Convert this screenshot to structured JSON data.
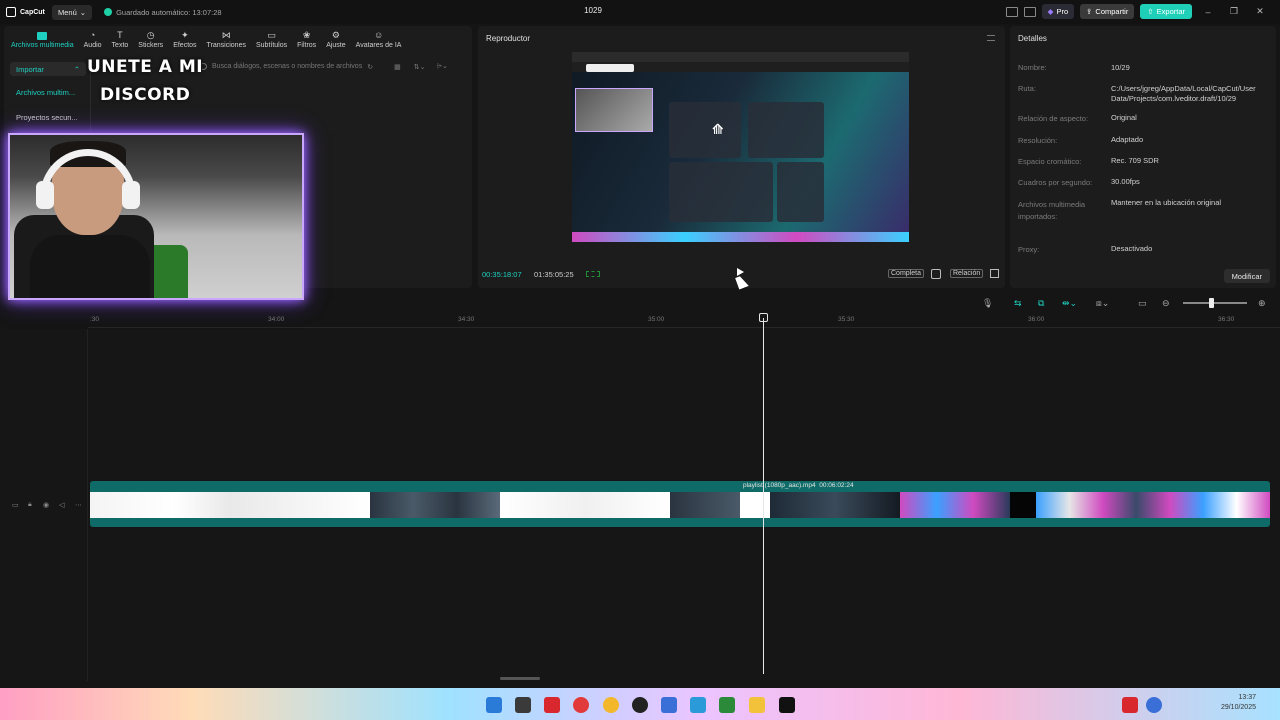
{
  "titlebar": {
    "app_name": "CapCut",
    "menu_label": "Menú",
    "autosave": "Guardado automático: 13:07:28",
    "project": "1029",
    "pro_label": "Pro",
    "share_label": "Compartir",
    "export_label": "Exportar"
  },
  "tools": [
    {
      "label": "Archivos multimedia",
      "icon": "media-icon"
    },
    {
      "label": "Audio",
      "icon": "audio-icon"
    },
    {
      "label": "Texto",
      "icon": "text-icon"
    },
    {
      "label": "Stickers",
      "icon": "sticker-icon"
    },
    {
      "label": "Efectos",
      "icon": "effects-icon"
    },
    {
      "label": "Transiciones",
      "icon": "transitions-icon"
    },
    {
      "label": "Subtítulos",
      "icon": "subtitles-icon"
    },
    {
      "label": "Filtros",
      "icon": "filters-icon"
    },
    {
      "label": "Ajuste",
      "icon": "adjust-icon"
    },
    {
      "label": "Avatares de IA",
      "icon": "avatar-icon"
    }
  ],
  "media": {
    "import_label": "Importar",
    "side_items": [
      "Archivos multim...",
      "Proyectos secun..."
    ],
    "search_placeholder": "Busca diálogos, escenas o nombres de archivos"
  },
  "overlay": {
    "line1": "UNETE A MI",
    "line2": "DISCORD"
  },
  "player": {
    "title": "Reproductor",
    "current_time": "00:35:18:07",
    "total_time": "01:35:05:25",
    "full_label": "Completa",
    "ratio_label": "Relación"
  },
  "details": {
    "title": "Detalles",
    "rows": [
      {
        "label": "Nombre:",
        "value": "10/29"
      },
      {
        "label": "Ruta:",
        "value": "C:/Users/jgreg/AppData/Local/CapCut/User Data/Projects/com.lveditor.draft/10/29"
      },
      {
        "label": "Relación de aspecto:",
        "value": "Original"
      },
      {
        "label": "Resolución:",
        "value": "Adaptado"
      },
      {
        "label": "Espacio cromático:",
        "value": "Rec. 709 SDR"
      },
      {
        "label": "Cuadros por segundo:",
        "value": "30.00fps"
      },
      {
        "label": "Archivos multimedia importados:",
        "value": "Mantener en la ubicación original"
      },
      {
        "label": "Proxy:",
        "value": "Desactivado"
      }
    ],
    "modify_label": "Modificar"
  },
  "timeline": {
    "ruler": [
      ":30",
      "34:00",
      "34:30",
      "35:00",
      "35:30",
      "36:00",
      "36:30"
    ],
    "clip_name": "playlist (1080p_aac).mp4",
    "clip_duration": "00:06:02:24"
  },
  "taskbar": {
    "time": "13:37",
    "date": "29/10/2025"
  }
}
